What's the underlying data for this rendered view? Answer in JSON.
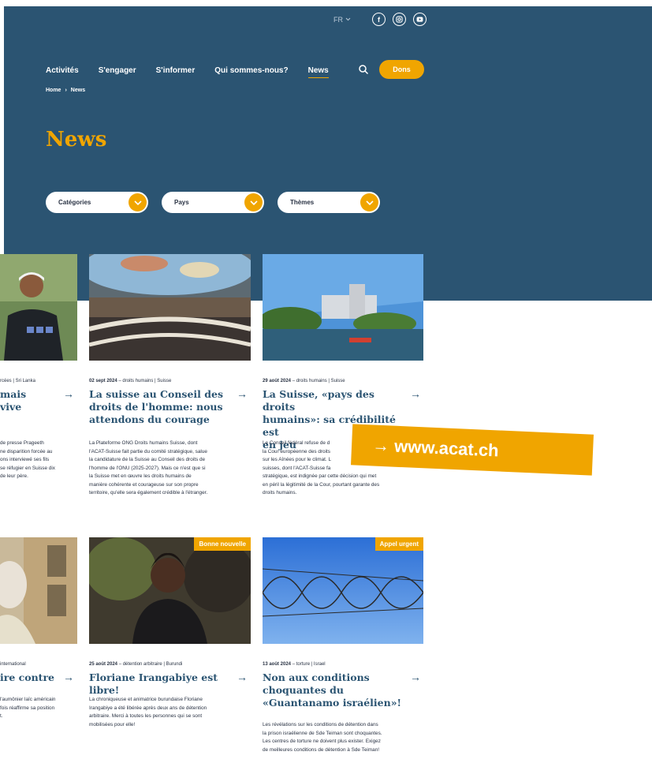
{
  "topbar": {
    "lang": "FR",
    "social": [
      "facebook-icon",
      "instagram-icon",
      "youtube-icon"
    ]
  },
  "nav": [
    "Activités",
    "S'engager",
    "S'informer",
    "Qui sommes-nous?",
    "News"
  ],
  "dons_label": "Dons",
  "breadcrumb": {
    "home": "Home",
    "sep": "›",
    "current": "News"
  },
  "page_title": "News",
  "filters": [
    "Catégories",
    "Pays",
    "Thèmes"
  ],
  "cards": [
    {
      "meta_date": "",
      "meta_tags": "rcées | Sri Lanka",
      "title": "mais\nvive",
      "excerpt": "de presse Prageeth\nne disparition forcée au\nons interviewé ses fils\nse réfugier en Suisse dix\nde leur père."
    },
    {
      "meta_date": "02 sept 2024",
      "meta_tags": "droits humains | Suisse",
      "title": "La suisse au Conseil des\ndroits de l'homme: nous\nattendons du courage",
      "excerpt": "La Plateforme ONG Droits humains Suisse, dont\nl'ACAT-Suisse fait partie du comité stratégique, salue\nla candidature de la Suisse au Conseil des droits de\nl'homme de l'ONU (2025-2027). Mais ce n'est que si\nla Suisse met en œuvre les droits humains de\nmanière cohérente et courageuse sur son propre\nterritoire, qu'elle sera également crédible à l'étranger."
    },
    {
      "meta_date": "29 août 2024",
      "meta_tags": "droits humains | Suisse",
      "title": "La Suisse, «pays des droits\nhumains»: sa crédibilité est\nen jeu",
      "excerpt": "Le Conseil fédéral refuse de d\nla Cour européenne des droits\nsur les Aînées pour le climat. L\nsuisses, dont l'ACAT-Suisse fa\nstratégique, est indignée par cette décision qui met\nen péril la légitimité de la Cour, pourtant garante des\ndroits humains."
    },
    {
      "meta_date": "",
      "meta_tags": "international",
      "title": "ire contre",
      "excerpt": "l'aumônier laïc américain\nfois réaffirme sa position\nt."
    },
    {
      "badge": "Bonne nouvelle",
      "meta_date": "25 août 2024",
      "meta_tags": "détention arbitraire | Burundi",
      "title": "Floriane Irangabiye est libre!",
      "excerpt": "La chroniqueuse et animatrice burundaise Floriane\nIrangabiye a été libérée après deux ans de détention\narbitraire. Merci à toutes les personnes qui se sont\nmobilisées pour elle!"
    },
    {
      "badge": "Appel urgent",
      "meta_date": "13 août 2024",
      "meta_tags": "torture | Israel",
      "title": "Non aux conditions\nchoquantes du\n«Guantanamo israélien»!",
      "excerpt": "Les révélations sur les conditions de détention dans\nla prison israélienne de Sde Teiman sont choquantes.\nLes centres de torture ne doivent plus exister. Exigez\nde meilleures conditions de détention à Sde Teiman!"
    }
  ],
  "arrow": "→",
  "banner": "→ www.acat.ch",
  "colors": {
    "navy": "#2b5472",
    "accent": "#f0a500"
  }
}
